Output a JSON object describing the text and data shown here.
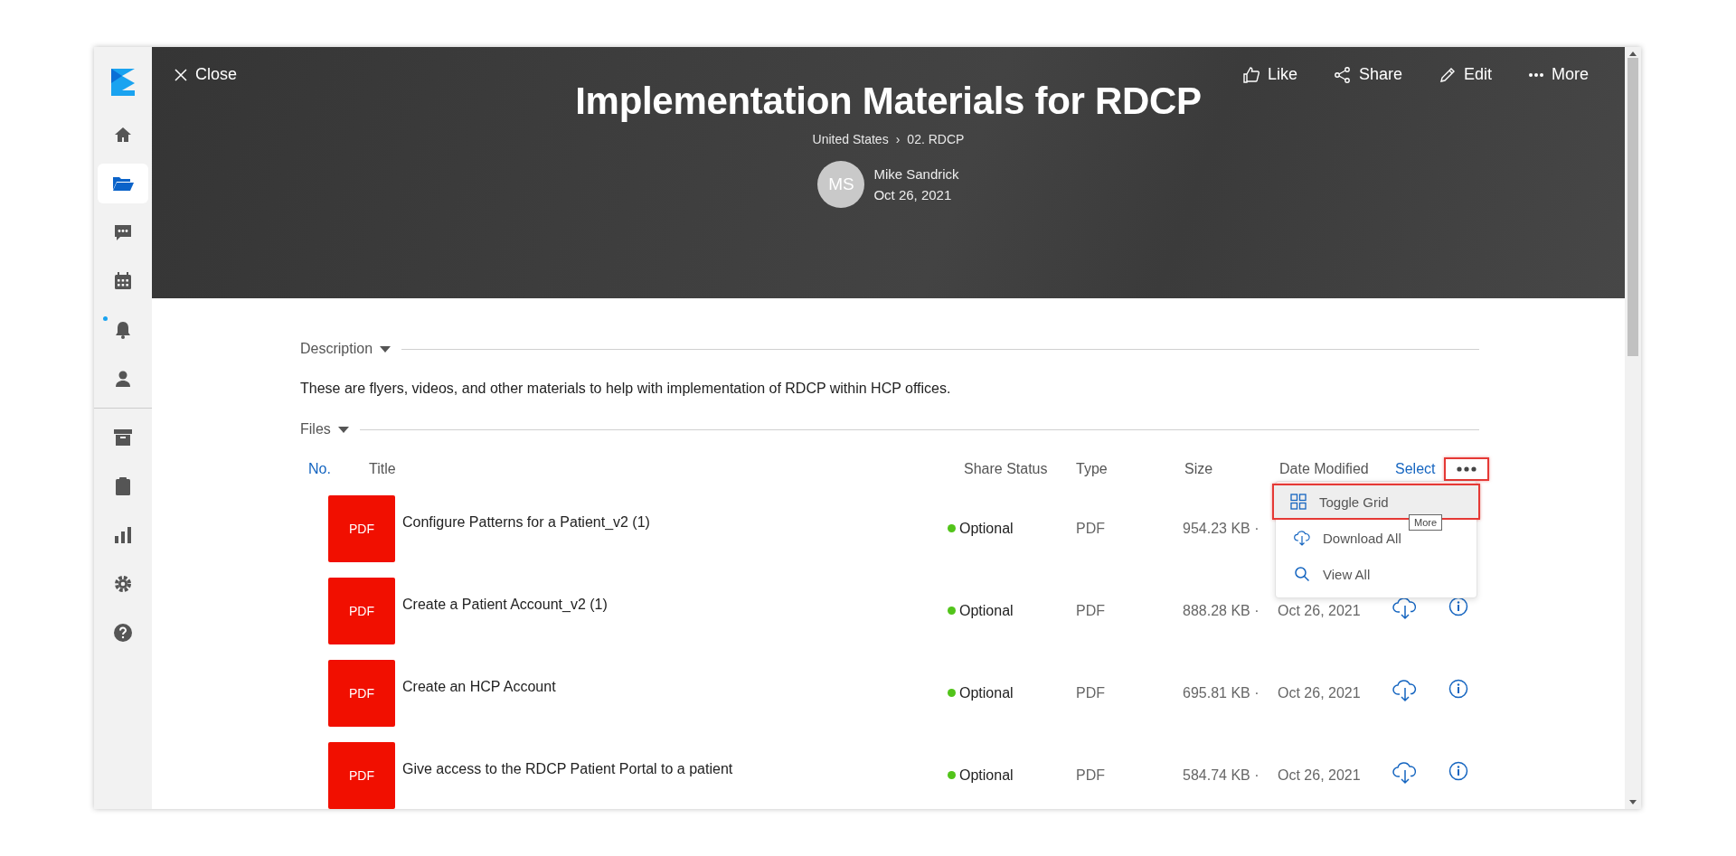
{
  "sidebar": {
    "groups": [
      {
        "items": [
          {
            "kind": "home",
            "selected": false,
            "badge": false
          },
          {
            "kind": "folder",
            "selected": true,
            "badge": false
          },
          {
            "kind": "chat",
            "selected": false,
            "badge": false
          },
          {
            "kind": "calendar",
            "selected": false,
            "badge": false
          },
          {
            "kind": "bell",
            "selected": false,
            "badge": true
          },
          {
            "kind": "person",
            "selected": false,
            "badge": false
          }
        ]
      },
      {
        "items": [
          {
            "kind": "archive",
            "selected": false,
            "badge": false
          },
          {
            "kind": "clipboard",
            "selected": false,
            "badge": false
          },
          {
            "kind": "chart",
            "selected": false,
            "badge": false
          },
          {
            "kind": "gear",
            "selected": false,
            "badge": false
          },
          {
            "kind": "help",
            "selected": false,
            "badge": false
          }
        ]
      }
    ]
  },
  "header": {
    "close_label": "Close",
    "actions": [
      {
        "kind": "like",
        "label": "Like"
      },
      {
        "kind": "share",
        "label": "Share"
      },
      {
        "kind": "edit",
        "label": "Edit"
      },
      {
        "kind": "more",
        "label": "More"
      }
    ],
    "title": "Implementation Materials for RDCP",
    "breadcrumb": [
      "United States",
      "02. RDCP"
    ],
    "breadcrumb_separator": "›",
    "author": {
      "initials": "MS",
      "name": "Mike Sandrick",
      "date": "Oct 26, 2021"
    }
  },
  "description": {
    "heading": "Description",
    "expanded": true,
    "text": "These are flyers, videos, and other materials to help with implementation of RDCP within HCP offices."
  },
  "files": {
    "heading": "Files",
    "expanded": true,
    "columns": [
      {
        "label": "No.",
        "sorted": true
      },
      {
        "label": "Title",
        "sorted": false
      },
      {
        "label": "Share Status",
        "sorted": false
      },
      {
        "label": "Type",
        "sorted": false
      },
      {
        "label": "Size",
        "sorted": false
      },
      {
        "label": "Date Modified",
        "sorted": false
      }
    ],
    "select_label": "Select",
    "more_button": {
      "expanded": true,
      "highlighted": true
    },
    "menu": [
      {
        "kind": "grid",
        "label": "Toggle Grid",
        "highlighted": true
      },
      {
        "kind": "download",
        "label": "Download All",
        "highlighted": false
      },
      {
        "kind": "search",
        "label": "View All",
        "highlighted": false
      }
    ],
    "tooltip": "More",
    "rows": [
      {
        "thumb": "PDF",
        "title": "Configure Patterns for a Patient_v2 (1)",
        "status": "Optional",
        "type": "PDF",
        "size": "954.23 KB ·"
      },
      {
        "thumb": "PDF",
        "title": "Create a Patient Account_v2 (1)",
        "status": "Optional",
        "type": "PDF",
        "size": "888.28 KB ·",
        "date": "Oct 26, 2021"
      },
      {
        "thumb": "PDF",
        "title": "Create an HCP Account",
        "status": "Optional",
        "type": "PDF",
        "size": "695.81 KB ·",
        "date": "Oct 26, 2021"
      },
      {
        "thumb": "PDF",
        "title": "Give access to the RDCP Patient Portal to a patient",
        "status": "Optional",
        "type": "PDF",
        "size": "584.74 KB ·",
        "date": "Oct 26, 2021"
      }
    ]
  }
}
